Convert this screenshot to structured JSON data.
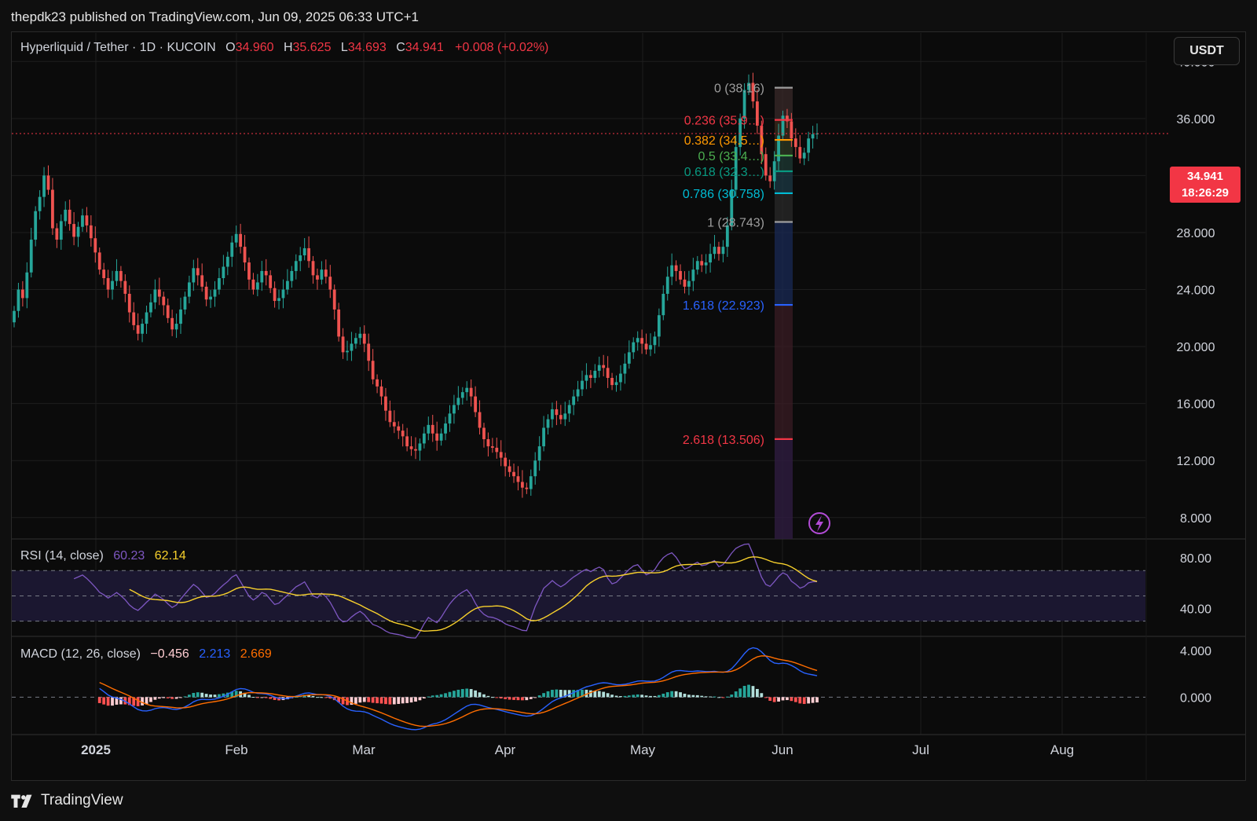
{
  "header": {
    "published": "thepdk23 published on TradingView.com, Jun 09, 2025 06:33 UTC+1"
  },
  "symbol": {
    "name": "Hyperliquid / Tether · 1D · KUCOIN",
    "o_label": "O",
    "o": "34.960",
    "h_label": "H",
    "h": "35.625",
    "l_label": "L",
    "l": "34.693",
    "c_label": "C",
    "c": "34.941",
    "change": "+0.008 (+0.02%)"
  },
  "currency_button": "USDT",
  "last_price": {
    "value": "34.941",
    "countdown": "18:26:29"
  },
  "rsi": {
    "label": "RSI (14, close)",
    "value": "60.23",
    "ma": "62.14"
  },
  "macd": {
    "label": "MACD (12, 26, close)",
    "hist": "−0.456",
    "macd": "2.213",
    "signal": "2.669"
  },
  "footer": {
    "brand": "TradingView"
  },
  "colors": {
    "up": "#26a69a",
    "down": "#ef5350",
    "bg": "#0b0b0b",
    "rsi": "#7e57c2",
    "rsi_ma": "#f7d02c",
    "macd": "#2962ff",
    "signal": "#ff6d00"
  },
  "icons": {
    "lightning": "lightning-icon",
    "logo": "tradingview-logo-icon"
  },
  "chart_data": {
    "type": "candlestick",
    "price_axis": {
      "ticks": [
        "40.000",
        "36.000",
        "32.000",
        "28.000",
        "24.000",
        "20.000",
        "16.000",
        "12.000",
        "8.000"
      ],
      "range": [
        6.5,
        42
      ]
    },
    "time_axis": {
      "labels": [
        "2025",
        "Feb",
        "Mar",
        "Apr",
        "May",
        "Jun",
        "Jul",
        "Aug"
      ]
    },
    "closes": [
      22.5,
      24.0,
      23.4,
      25.2,
      27.5,
      29.5,
      30.5,
      32.0,
      31.0,
      28.3,
      27.5,
      28.8,
      29.6,
      28.6,
      27.7,
      28.4,
      29.2,
      28.5,
      27.6,
      26.6,
      25.4,
      24.8,
      24.0,
      24.6,
      25.3,
      24.6,
      23.7,
      22.4,
      21.5,
      20.9,
      21.6,
      22.4,
      23.1,
      24.0,
      23.5,
      22.9,
      22.0,
      21.2,
      21.6,
      22.6,
      23.5,
      24.5,
      25.5,
      25.0,
      24.2,
      23.3,
      23.5,
      24.0,
      24.8,
      25.6,
      26.3,
      27.3,
      27.9,
      27.0,
      25.9,
      24.7,
      24.0,
      24.5,
      25.3,
      25.0,
      24.1,
      23.2,
      23.4,
      24.0,
      24.6,
      25.3,
      26.0,
      26.4,
      26.9,
      26.0,
      25.0,
      24.7,
      25.4,
      24.9,
      24.0,
      22.6,
      20.7,
      19.6,
      19.7,
      20.2,
      20.6,
      20.9,
      20.2,
      19.0,
      17.7,
      17.2,
      16.5,
      15.5,
      14.7,
      14.4,
      14.1,
      13.7,
      13.0,
      12.8,
      12.7,
      13.2,
      13.9,
      14.5,
      13.9,
      13.4,
      13.9,
      14.6,
      15.3,
      15.9,
      16.4,
      16.8,
      17.1,
      16.5,
      15.4,
      14.3,
      13.5,
      13.0,
      12.9,
      12.6,
      12.2,
      11.6,
      11.2,
      10.9,
      10.5,
      10.1,
      10.0,
      10.9,
      12.0,
      13.0,
      14.3,
      14.9,
      15.6,
      15.2,
      14.9,
      15.3,
      15.9,
      16.5,
      17.0,
      17.6,
      18.0,
      17.8,
      18.3,
      18.7,
      18.5,
      17.8,
      17.3,
      17.5,
      18.1,
      18.8,
      19.6,
      20.3,
      20.6,
      20.2,
      19.8,
      20.1,
      20.7,
      22.2,
      23.7,
      24.9,
      25.7,
      25.3,
      24.7,
      24.2,
      24.6,
      25.4,
      26.0,
      25.7,
      25.9,
      26.5,
      27.0,
      26.5,
      27.0,
      28.5,
      31.0,
      34.0,
      36.0,
      38.0,
      38.5,
      37.2,
      35.5,
      33.5,
      32.0,
      31.6,
      33.0,
      34.8,
      36.2,
      35.8,
      34.6,
      34.0,
      33.2,
      33.6,
      34.6,
      34.9,
      34.941
    ],
    "fibonacci": [
      {
        "level": "0",
        "price": "38.16",
        "label": "0 (38.16)",
        "color": "#9e9e9e"
      },
      {
        "level": "0.236",
        "price": "35.9",
        "label": "0.236 (35.9…)",
        "color": "#f23645"
      },
      {
        "level": "0.382",
        "price": "34.5",
        "label": "0.382 (34.5…)",
        "color": "#ff9800"
      },
      {
        "level": "0.5",
        "price": "33.4",
        "label": "0.5 (33.4…)",
        "color": "#4caf50"
      },
      {
        "level": "0.618",
        "price": "32.3",
        "label": "0.618 (32.3…)",
        "color": "#089981"
      },
      {
        "level": "0.786",
        "price": "30.758",
        "label": "0.786 (30.758)",
        "color": "#00bcd4"
      },
      {
        "level": "1",
        "price": "28.743",
        "label": "1 (28.743)",
        "color": "#9e9e9e"
      },
      {
        "level": "1.618",
        "price": "22.923",
        "label": "1.618 (22.923)",
        "color": "#2962ff"
      },
      {
        "level": "2.618",
        "price": "13.506",
        "label": "2.618 (13.506)",
        "color": "#f23645"
      }
    ],
    "rsi_axis": {
      "ticks": [
        "80.00",
        "40.00"
      ],
      "range": [
        18,
        95
      ],
      "bands": [
        70,
        50,
        30
      ]
    },
    "macd_axis": {
      "ticks": [
        "4.000",
        "0.000"
      ],
      "range": [
        -3.2,
        5.2
      ]
    }
  }
}
